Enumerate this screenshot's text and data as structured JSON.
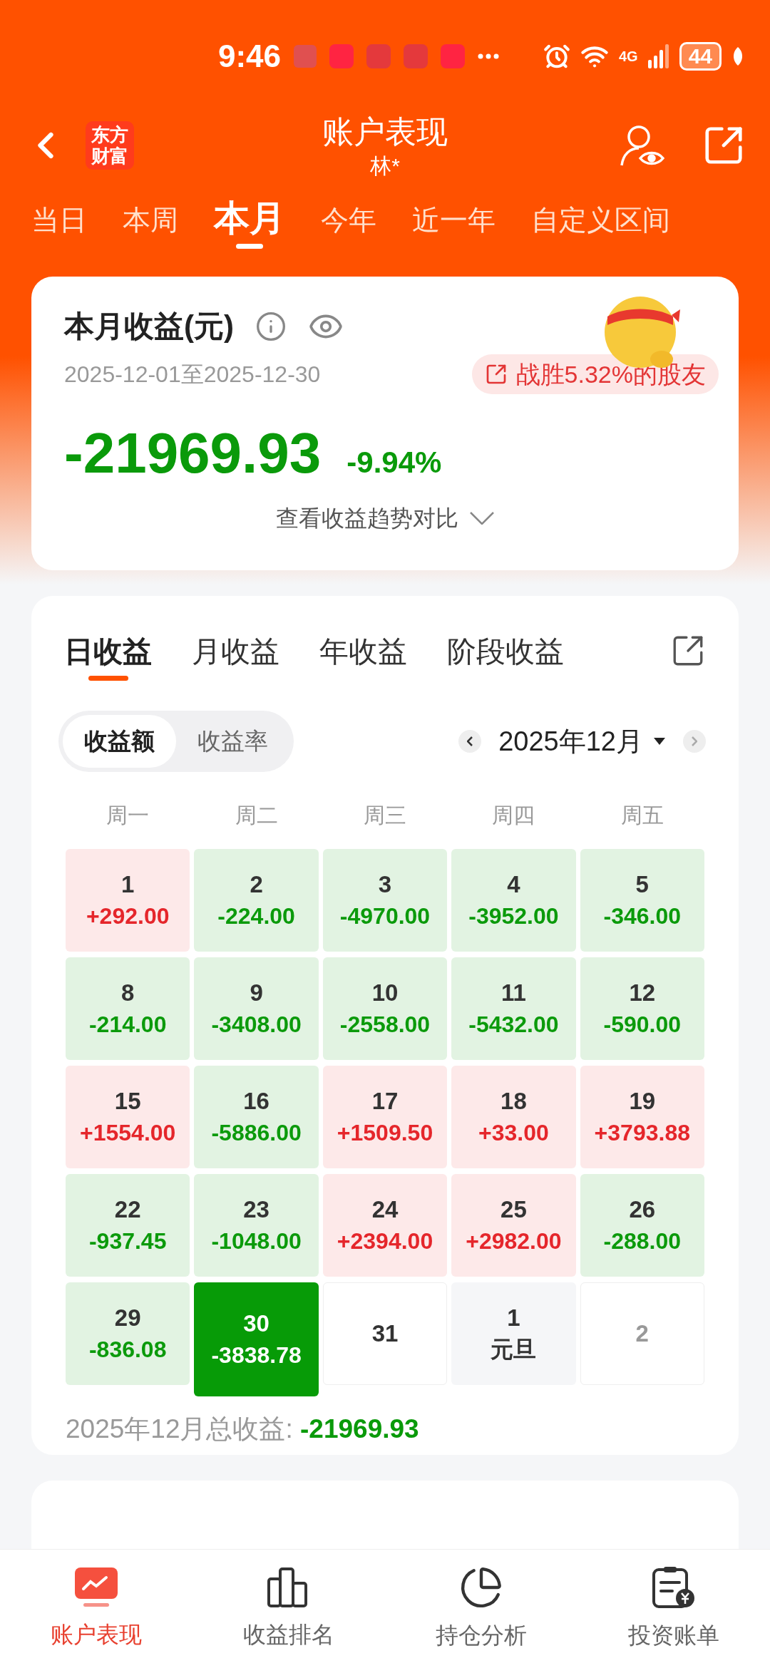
{
  "status_bar": {
    "time": "9:46",
    "network": "4G",
    "battery": "44"
  },
  "header": {
    "logo": "东方财富",
    "title": "账户表现",
    "subtitle": "林*"
  },
  "period_tabs": [
    {
      "label": "当日",
      "selected": false
    },
    {
      "label": "本周",
      "selected": false
    },
    {
      "label": "本月",
      "selected": true
    },
    {
      "label": "今年",
      "selected": false
    },
    {
      "label": "近一年",
      "selected": false
    },
    {
      "label": "自定义区间",
      "selected": false
    }
  ],
  "summary": {
    "title": "本月收益(元)",
    "date_range": "2025-12-01至2025-12-30",
    "rank_badge": "战胜5.32%的股友",
    "amount": "-21969.93",
    "percent": "-9.94%",
    "trend_link": "查看收益趋势对比"
  },
  "earnings": {
    "tabs": [
      {
        "label": "日收益",
        "selected": true
      },
      {
        "label": "月收益",
        "selected": false
      },
      {
        "label": "年收益",
        "selected": false
      },
      {
        "label": "阶段收益",
        "selected": false
      }
    ],
    "toggle": [
      {
        "label": "收益额",
        "selected": true
      },
      {
        "label": "收益率",
        "selected": false
      }
    ],
    "month": "2025年12月",
    "weekdays": [
      "周一",
      "周二",
      "周三",
      "周四",
      "周五"
    ],
    "days": [
      {
        "day": "1",
        "value": "+292.00",
        "kind": "gain",
        "selected": false
      },
      {
        "day": "2",
        "value": "-224.00",
        "kind": "loss",
        "selected": false
      },
      {
        "day": "3",
        "value": "-4970.00",
        "kind": "loss",
        "selected": false
      },
      {
        "day": "4",
        "value": "-3952.00",
        "kind": "loss",
        "selected": false
      },
      {
        "day": "5",
        "value": "-346.00",
        "kind": "loss",
        "selected": false
      },
      {
        "day": "8",
        "value": "-214.00",
        "kind": "loss",
        "selected": false
      },
      {
        "day": "9",
        "value": "-3408.00",
        "kind": "loss",
        "selected": false
      },
      {
        "day": "10",
        "value": "-2558.00",
        "kind": "loss",
        "selected": false
      },
      {
        "day": "11",
        "value": "-5432.00",
        "kind": "loss",
        "selected": false
      },
      {
        "day": "12",
        "value": "-590.00",
        "kind": "loss",
        "selected": false
      },
      {
        "day": "15",
        "value": "+1554.00",
        "kind": "gain",
        "selected": false
      },
      {
        "day": "16",
        "value": "-5886.00",
        "kind": "loss",
        "selected": false
      },
      {
        "day": "17",
        "value": "+1509.50",
        "kind": "gain",
        "selected": false
      },
      {
        "day": "18",
        "value": "+33.00",
        "kind": "gain",
        "selected": false
      },
      {
        "day": "19",
        "value": "+3793.88",
        "kind": "gain",
        "selected": false
      },
      {
        "day": "22",
        "value": "-937.45",
        "kind": "loss",
        "selected": false
      },
      {
        "day": "23",
        "value": "-1048.00",
        "kind": "loss",
        "selected": false
      },
      {
        "day": "24",
        "value": "+2394.00",
        "kind": "gain",
        "selected": false
      },
      {
        "day": "25",
        "value": "+2982.00",
        "kind": "gain",
        "selected": false
      },
      {
        "day": "26",
        "value": "-288.00",
        "kind": "loss",
        "selected": false
      },
      {
        "day": "29",
        "value": "-836.08",
        "kind": "loss",
        "selected": false
      },
      {
        "day": "30",
        "value": "-3838.78",
        "kind": "loss",
        "selected": true
      },
      {
        "day": "31",
        "kind": "blank",
        "selected": false
      },
      {
        "day": "1",
        "note": "元旦",
        "kind": "holiday",
        "selected": false
      },
      {
        "day": "2",
        "kind": "next_month",
        "selected": false
      }
    ],
    "total_label": "2025年12月总收益:",
    "total_value": "-21969.93"
  },
  "bottom_nav": [
    {
      "label": "账户表现",
      "selected": true
    },
    {
      "label": "收益排名",
      "selected": false
    },
    {
      "label": "持仓分析",
      "selected": false
    },
    {
      "label": "投资账单",
      "selected": false
    }
  ]
}
